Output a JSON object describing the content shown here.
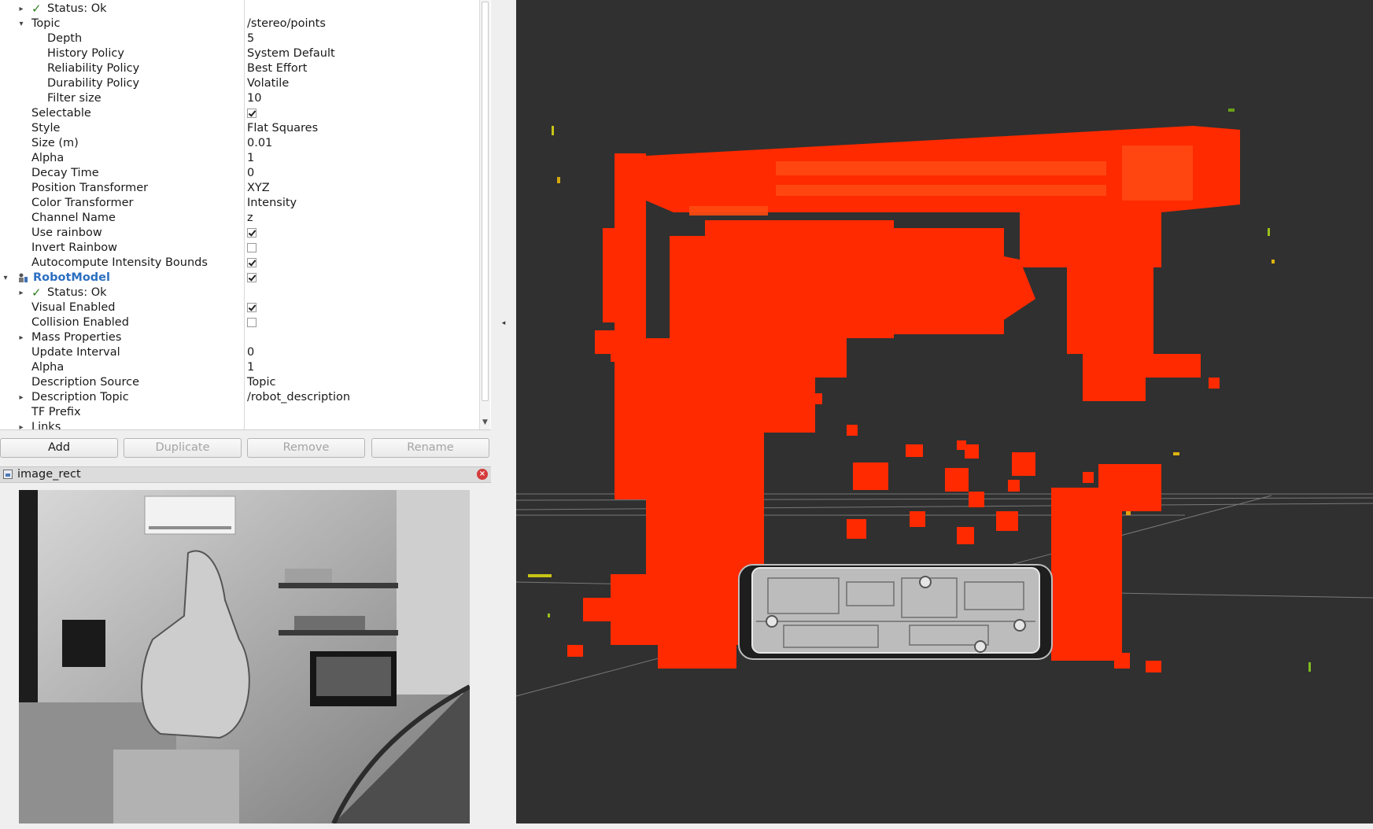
{
  "tree_rows": [
    {
      "type": "status",
      "indent": 0,
      "arrow": "right",
      "label": "Status: Ok"
    },
    {
      "type": "prop",
      "indent": 0,
      "arrow": "down",
      "label": "Topic",
      "value": "/stereo/points"
    },
    {
      "type": "prop",
      "indent": 1,
      "label": "Depth",
      "value": "5"
    },
    {
      "type": "prop",
      "indent": 1,
      "label": "History Policy",
      "value": "System Default"
    },
    {
      "type": "prop",
      "indent": 1,
      "label": "Reliability Policy",
      "value": "Best Effort"
    },
    {
      "type": "prop",
      "indent": 1,
      "label": "Durability Policy",
      "value": "Volatile"
    },
    {
      "type": "prop",
      "indent": 1,
      "label": "Filter size",
      "value": "10"
    },
    {
      "type": "check",
      "indent": 0,
      "label": "Selectable",
      "checked": true
    },
    {
      "type": "prop",
      "indent": 0,
      "label": "Style",
      "value": "Flat Squares"
    },
    {
      "type": "prop",
      "indent": 0,
      "label": "Size (m)",
      "value": "0.01"
    },
    {
      "type": "prop",
      "indent": 0,
      "label": "Alpha",
      "value": "1"
    },
    {
      "type": "prop",
      "indent": 0,
      "label": "Decay Time",
      "value": "0"
    },
    {
      "type": "prop",
      "indent": 0,
      "label": "Position Transformer",
      "value": "XYZ"
    },
    {
      "type": "prop",
      "indent": 0,
      "label": "Color Transformer",
      "value": "Intensity"
    },
    {
      "type": "prop",
      "indent": 0,
      "label": "Channel Name",
      "value": "z"
    },
    {
      "type": "check",
      "indent": 0,
      "label": "Use rainbow",
      "checked": true
    },
    {
      "type": "check",
      "indent": 0,
      "label": "Invert Rainbow",
      "checked": false
    },
    {
      "type": "check",
      "indent": 0,
      "label": "Autocompute Intensity Bounds",
      "checked": true
    },
    {
      "type": "plugin",
      "indent": -1,
      "arrow": "down",
      "label": "RobotModel",
      "checked": true
    },
    {
      "type": "status",
      "indent": 0,
      "arrow": "right",
      "label": "Status: Ok"
    },
    {
      "type": "check",
      "indent": 0,
      "label": "Visual Enabled",
      "checked": true
    },
    {
      "type": "check",
      "indent": 0,
      "label": "Collision Enabled",
      "checked": false
    },
    {
      "type": "prop",
      "indent": 0,
      "arrow": "right",
      "label": "Mass Properties",
      "value": ""
    },
    {
      "type": "prop",
      "indent": 0,
      "label": "Update Interval",
      "value": "0"
    },
    {
      "type": "prop",
      "indent": 0,
      "label": "Alpha",
      "value": "1"
    },
    {
      "type": "prop",
      "indent": 0,
      "label": "Description Source",
      "value": "Topic"
    },
    {
      "type": "prop",
      "indent": 0,
      "arrow": "right",
      "label": "Description Topic",
      "value": "/robot_description"
    },
    {
      "type": "prop",
      "indent": 0,
      "label": "TF Prefix",
      "value": ""
    },
    {
      "type": "prop",
      "indent": 0,
      "arrow": "right",
      "label": "Links",
      "value": ""
    }
  ],
  "buttons": {
    "add": "Add",
    "duplicate": "Duplicate",
    "remove": "Remove",
    "rename": "Rename"
  },
  "image_panel": {
    "title": "image_rect"
  },
  "colors": {
    "viewport_bg": "#303030",
    "point_red": "#ff2a00",
    "point_orange": "#ff4a12",
    "plugin_name": "#2c6fc2",
    "status_check": "#2e7d1f"
  }
}
